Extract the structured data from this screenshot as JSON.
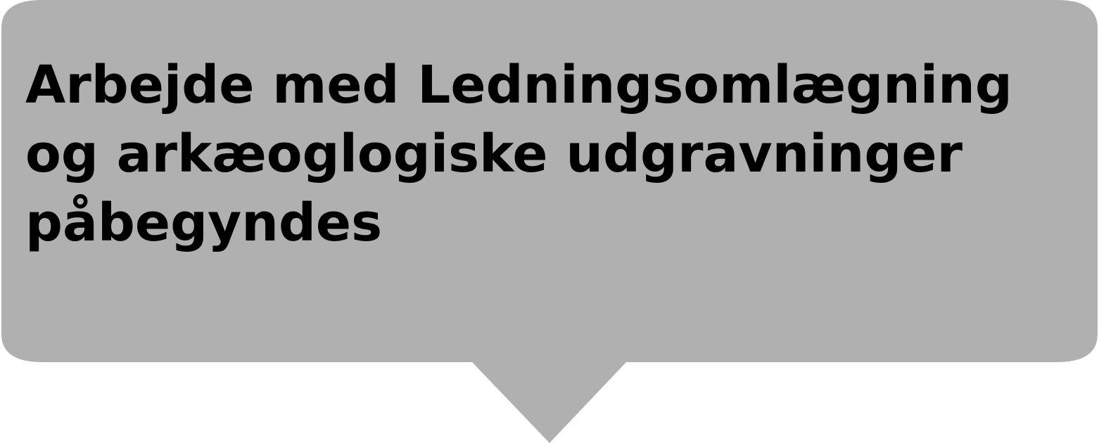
{
  "callout": {
    "text": "Arbejde med Ledningsomlægning\nog arkæoglogiske udgravninger\npåbegyndes",
    "fill_color": "#b0b0b0",
    "text_color": "#000000",
    "background_color": "#ffffff"
  }
}
